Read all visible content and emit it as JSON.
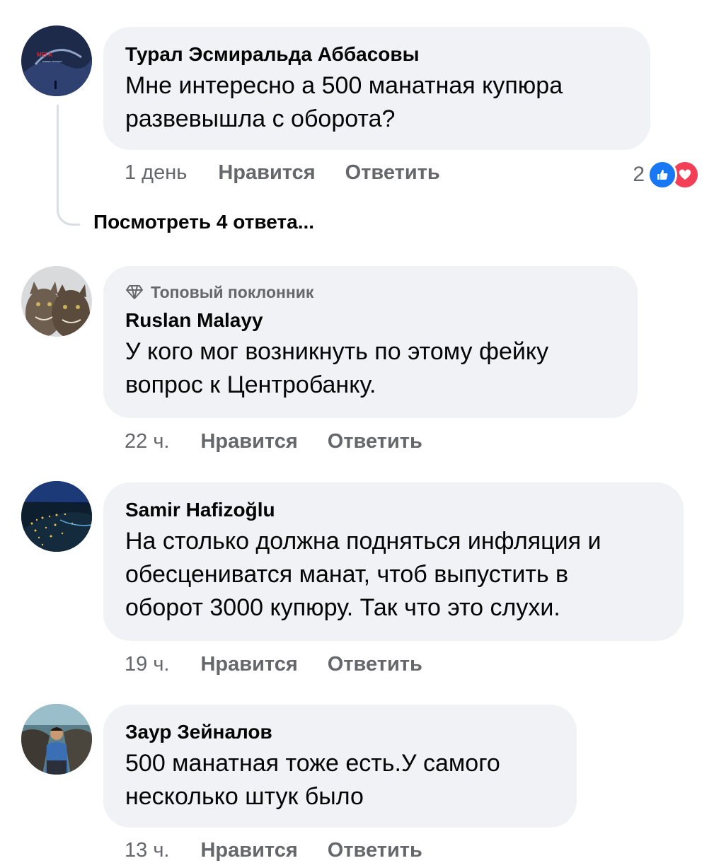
{
  "comments": [
    {
      "author": "Турал Эсмиральда Аббасовы",
      "text_lines": [
        "Мне интересно а 500 манатная купюра",
        "развевышла с оборота?"
      ],
      "time": "1 день",
      "like_label": "Нравится",
      "reply_label": "Ответить",
      "reaction_count": "2",
      "avatar_logo_text": "МЕГА",
      "avatar_logo_sub": "новые станции"
    },
    {
      "badge": "Топовый поклонник",
      "author": "Ruslan Malayy",
      "text_lines": [
        "У кого мог возникнуть по этому фейку",
        "вопрос к Центробанку."
      ],
      "time": "22 ч.",
      "like_label": "Нравится",
      "reply_label": "Ответить"
    },
    {
      "author": "Samir Hafizoğlu",
      "text_lines": [
        "На столько должна подняться инфляция и",
        "обесцениватся манат, чтоб выпустить в",
        "оборот 3000 купюру. Так что это слухи."
      ],
      "time": "19 ч.",
      "like_label": "Нравится",
      "reply_label": "Ответить"
    },
    {
      "author": "Заур Зейналов",
      "text_lines": [
        "500 манатная тоже есть.У самого",
        "несколько штук было"
      ],
      "time": "13 ч.",
      "like_label": "Нравится",
      "reply_label": "Ответить"
    }
  ],
  "view_replies": "Посмотреть 4 ответа...",
  "icons": {
    "like": "like-icon",
    "love": "love-icon",
    "badge": "diamond-icon"
  },
  "colors": {
    "bubble": "#f0f2f5",
    "meta_text": "#65676b",
    "like_blue": "#1877f2",
    "love_red": "#f33e58"
  }
}
